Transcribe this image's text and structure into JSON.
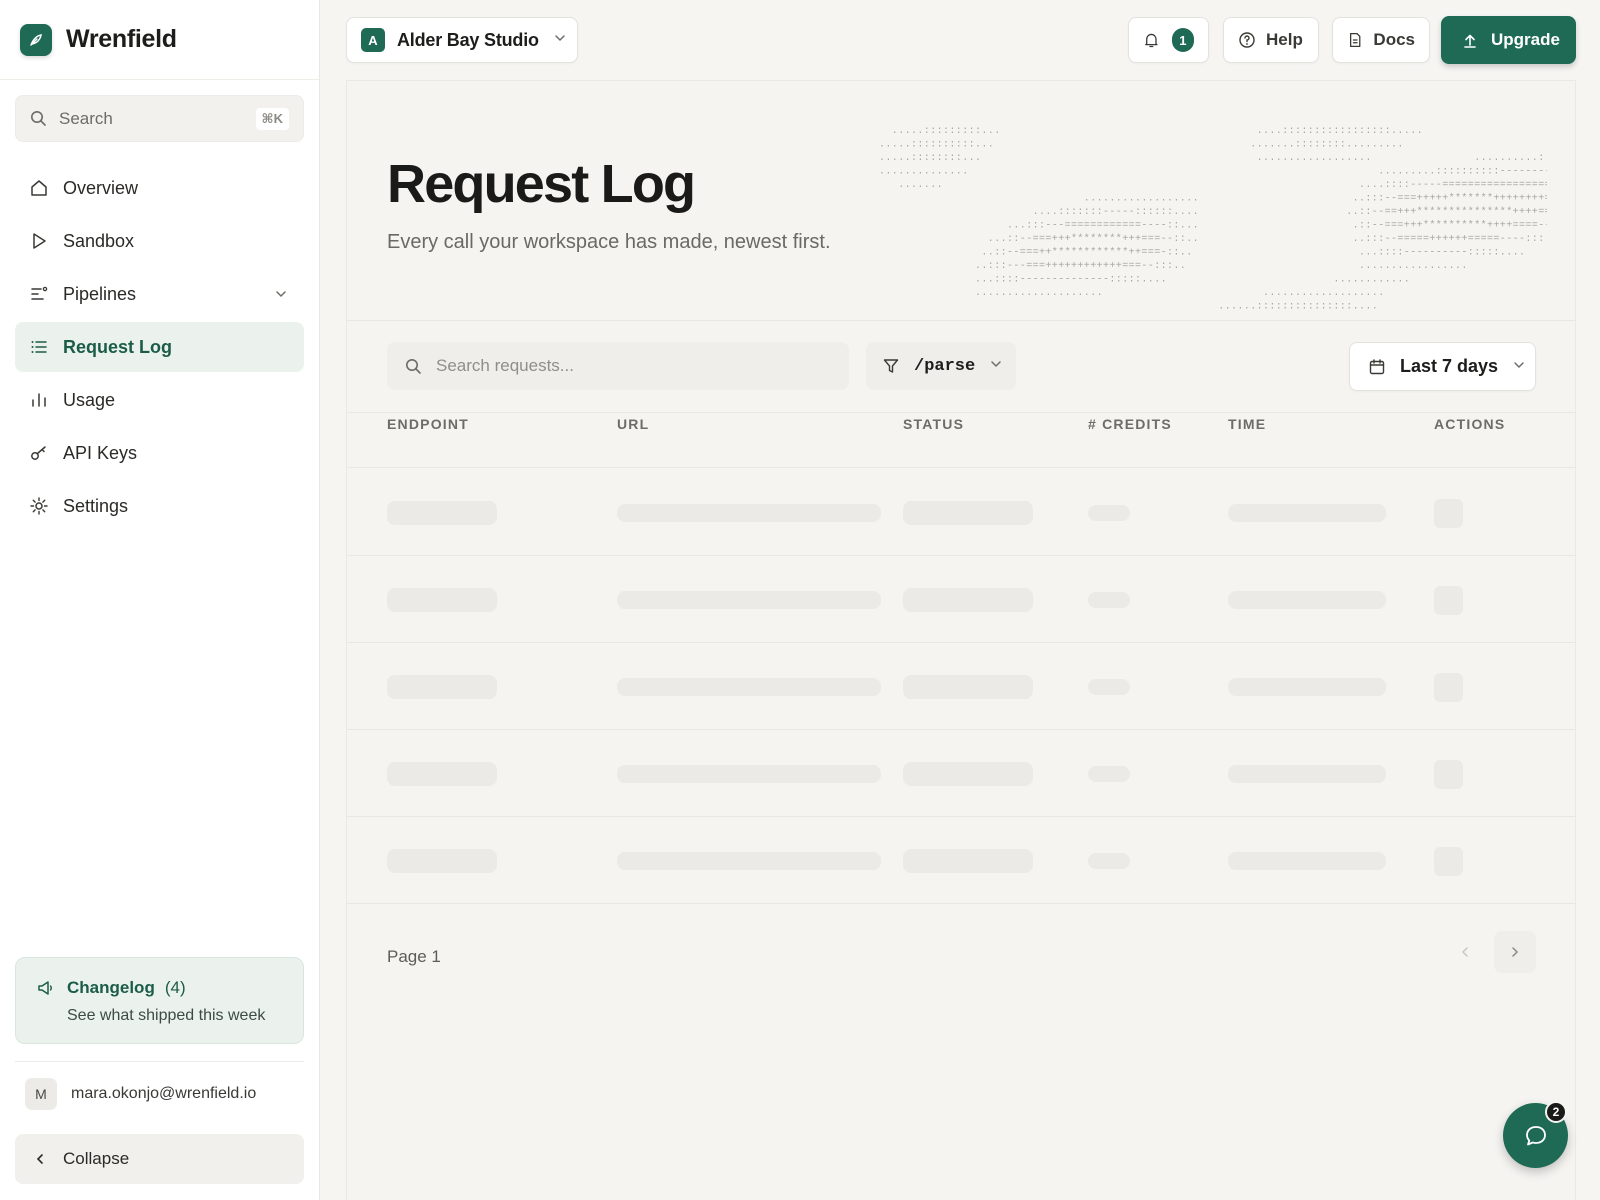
{
  "brand": {
    "name": "Wrenfield",
    "logo_icon": "feather-icon",
    "accent": "#1e6a55"
  },
  "search": {
    "label": "Search",
    "shortcut": "⌘K"
  },
  "nav": {
    "items": [
      {
        "label": "Overview",
        "icon": "home-icon"
      },
      {
        "label": "Sandbox",
        "icon": "play-icon"
      },
      {
        "label": "Pipelines",
        "icon": "pipelines-icon",
        "expandable": true
      },
      {
        "label": "Request Log",
        "icon": "list-icon",
        "active": true
      },
      {
        "label": "Usage",
        "icon": "bar-chart-icon"
      },
      {
        "label": "API Keys",
        "icon": "key-icon"
      },
      {
        "label": "Settings",
        "icon": "gear-icon"
      }
    ]
  },
  "changelog": {
    "title": "Changelog",
    "count": "(4)",
    "subtitle": "See what shipped this week"
  },
  "user": {
    "initial": "M",
    "email": "mara.okonjo@wrenfield.io"
  },
  "collapse": {
    "label": "Collapse"
  },
  "workspace": {
    "badge": "A",
    "name": "Alder Bay Studio"
  },
  "topbar": {
    "notifications_count": "1",
    "help_label": "Help",
    "docs_label": "Docs",
    "upgrade_label": "Upgrade"
  },
  "page": {
    "title": "Request Log",
    "subtitle": "Every call your workspace has made, newest first."
  },
  "toolbar": {
    "search_placeholder": "Search requests...",
    "filter_value": "/parse",
    "date_range": "Last 7 days"
  },
  "table": {
    "columns": [
      "ENDPOINT",
      "URL",
      "STATUS",
      "# CREDITS",
      "TIME",
      "ACTIONS"
    ],
    "loading_rows": 5
  },
  "pagination": {
    "label": "Page 1"
  },
  "chat": {
    "unread": "2"
  }
}
